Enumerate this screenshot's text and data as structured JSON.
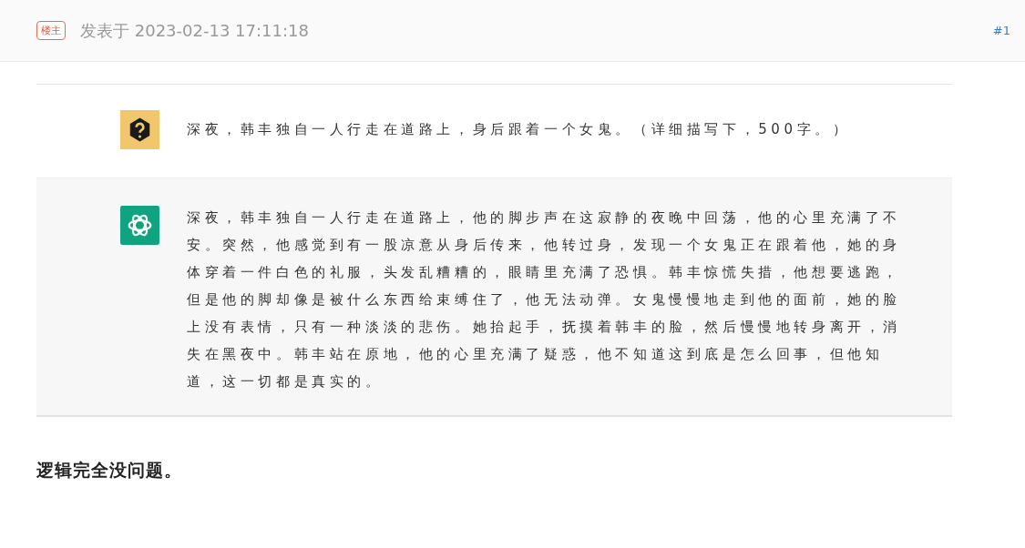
{
  "post_header": {
    "badge": "楼主",
    "posted_at": "发表于 2023-02-13 17:11:18",
    "floor": "#1"
  },
  "conversation": [
    {
      "kind": "question",
      "text": "深夜，韩丰独自一人行走在道路上，身后跟着一个女鬼。（详细描写下，500字。）"
    },
    {
      "kind": "answer",
      "text": "深夜，韩丰独自一人行走在道路上，他的脚步声在这寂静的夜晚中回荡，他的心里充满了不安。突然，他感觉到有一股凉意从身后传来，他转过身，发现一个女鬼正在跟着他，她的身体穿着一件白色的礼服，头发乱糟糟的，眼睛里充满了恐惧。韩丰惊慌失措，他想要逃跑，但是他的脚却像是被什么东西给束缚住了，他无法动弹。女鬼慢慢地走到他的面前，她的脸上没有表情，只有一种淡淡的悲伤。她抬起手，抚摸着韩丰的脸，然后慢慢地转身离开，消失在黑夜中。韩丰站在原地，他的心里充满了疑惑，他不知道这到底是怎么回事，但他知道，这一切都是真实的。"
    }
  ],
  "comment": "逻辑完全没问题。"
}
